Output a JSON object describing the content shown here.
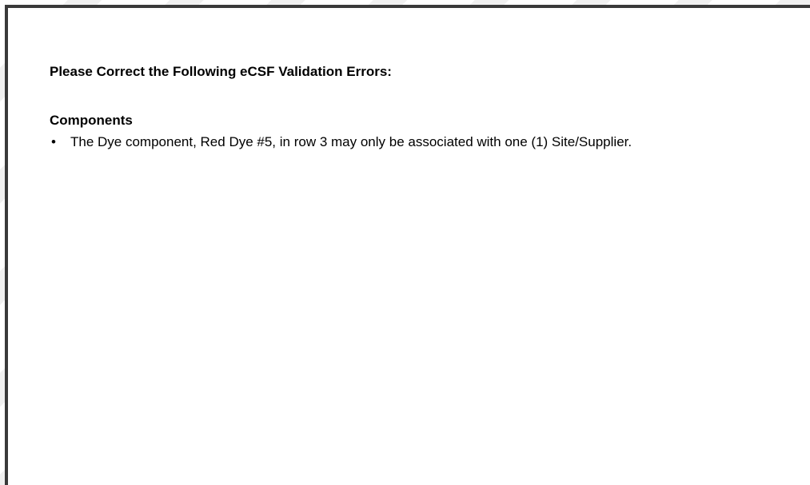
{
  "dialog": {
    "heading": "Please Correct the Following eCSF Validation Errors:",
    "sections": [
      {
        "title": "Components",
        "errors": [
          "The Dye component, Red Dye #5,  in row 3 may only be associated with one (1) Site/Supplier."
        ]
      }
    ]
  },
  "colors": {
    "border": "#3a3a3a",
    "text": "#000000",
    "background": "#ffffff"
  },
  "icons": {
    "bullet": "bullet-icon"
  }
}
